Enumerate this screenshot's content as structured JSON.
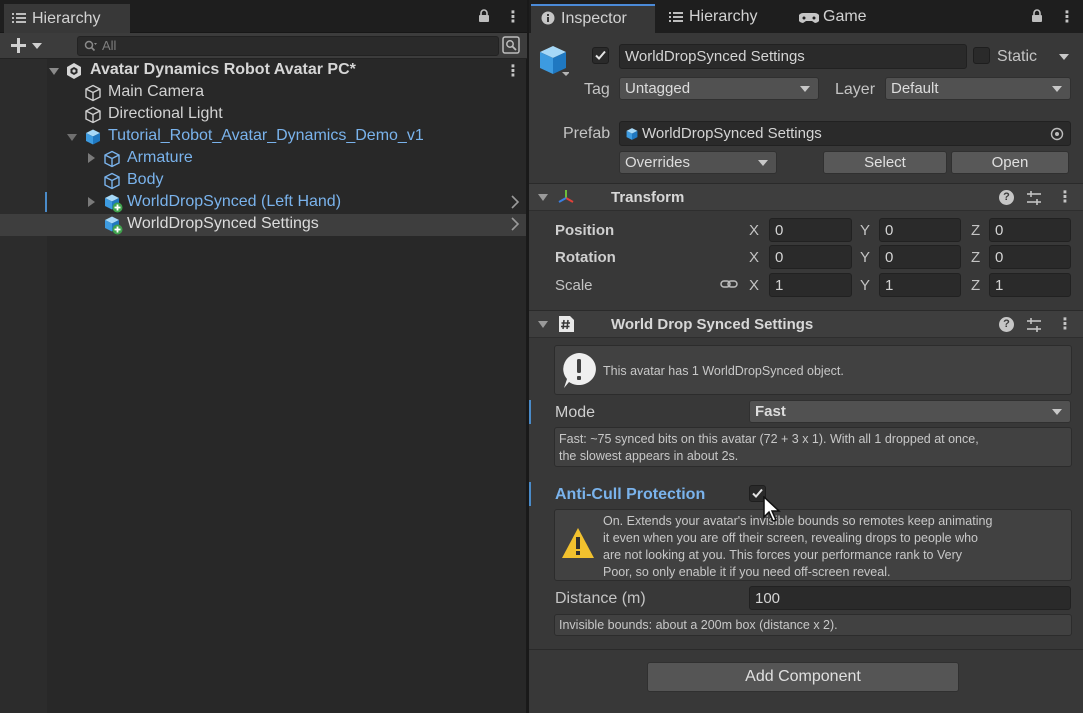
{
  "hierarchy": {
    "tab_label": "Hierarchy",
    "search_placeholder": "All",
    "items": [
      {
        "label": "Avatar Dynamics Robot Avatar PC*"
      },
      {
        "label": "Main Camera"
      },
      {
        "label": "Directional Light"
      },
      {
        "label": "Tutorial_Robot_Avatar_Dynamics_Demo_v1"
      },
      {
        "label": "Armature"
      },
      {
        "label": "Body"
      },
      {
        "label": "WorldDropSynced (Left Hand)"
      },
      {
        "label": "WorldDropSynced Settings"
      }
    ]
  },
  "inspector": {
    "tabs": [
      {
        "label": "Inspector"
      },
      {
        "label": "Hierarchy"
      },
      {
        "label": "Game"
      }
    ],
    "object": {
      "name": "WorldDropSynced Settings",
      "static_label": "Static",
      "tag_label": "Tag",
      "tag_value": "Untagged",
      "layer_label": "Layer",
      "layer_value": "Default",
      "prefab_label": "Prefab",
      "prefab_value": "WorldDropSynced Settings",
      "overrides_label": "Overrides",
      "select_label": "Select",
      "open_label": "Open"
    },
    "transform": {
      "title": "Transform",
      "position_label": "Position",
      "rotation_label": "Rotation",
      "scale_label": "Scale",
      "axis_x": "X",
      "axis_y": "Y",
      "axis_z": "Z",
      "position": {
        "x": "0",
        "y": "0",
        "z": "0"
      },
      "rotation": {
        "x": "0",
        "y": "0",
        "z": "0"
      },
      "scale": {
        "x": "1",
        "y": "1",
        "z": "1"
      }
    },
    "wds": {
      "title": "World Drop Synced Settings",
      "info_text": "This avatar has 1 WorldDropSynced object.",
      "mode_label": "Mode",
      "mode_value": "Fast",
      "mode_help_1": "Fast: ~75 synced bits on this avatar (72 + 3 x 1). With all 1 dropped at once,",
      "mode_help_2": "the slowest appears in about 2s.",
      "anticull_label": "Anti-Cull Protection",
      "warn_1": "On. Extends your avatar's invisible bounds so remotes keep animating",
      "warn_2": "it even when you are off their screen, revealing drops to people who",
      "warn_3": "are not looking at you. This forces your performance rank to Very",
      "warn_4": "Poor, so only enable it if you need off-screen reveal.",
      "distance_label": "Distance (m)",
      "distance_value": "100",
      "distance_help": "Invisible bounds: about a 200m box (distance x 2)."
    },
    "add_component_label": "Add Component"
  }
}
